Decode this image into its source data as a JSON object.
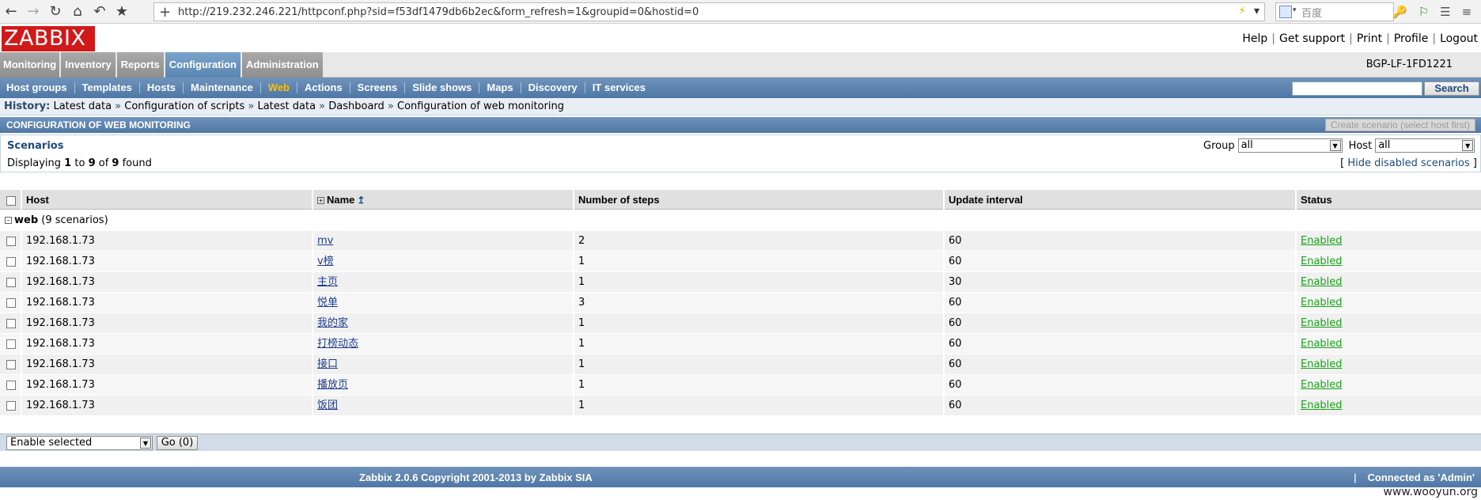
{
  "browser": {
    "url": "http://219.232.246.221/httpconf.php?sid=f53df1479db6b2ec&form_refresh=1&groupid=0&hostid=0",
    "search_placeholder": "百度"
  },
  "header": {
    "logo": "ZABBIX",
    "links": [
      "Help",
      "Get support",
      "Print",
      "Profile",
      "Logout"
    ],
    "node_name": "BGP-LF-1FD1221"
  },
  "main_menu": [
    "Monitoring",
    "Inventory",
    "Reports",
    "Configuration",
    "Administration"
  ],
  "sub_menu": [
    "Host groups",
    "Templates",
    "Hosts",
    "Maintenance",
    "Web",
    "Actions",
    "Screens",
    "Slide shows",
    "Maps",
    "Discovery",
    "IT services"
  ],
  "search_button": "Search",
  "history": {
    "label": "History:",
    "items": [
      "Latest data",
      "Configuration of scripts",
      "Latest data",
      "Dashboard",
      "Configuration of web monitoring"
    ]
  },
  "title": "CONFIGURATION OF WEB MONITORING",
  "create_button": "Create scenario (select host first)",
  "filter": {
    "section_title": "Scenarios",
    "displaying_prefix": "Displaying",
    "from": "1",
    "to_word": "to",
    "to": "9",
    "of_word": "of",
    "total": "9",
    "found_word": "found",
    "group_label": "Group",
    "group_value": "all",
    "host_label": "Host",
    "host_value": "all",
    "hide_disabled": "Hide disabled scenarios"
  },
  "table": {
    "headers": [
      "Host",
      "Name",
      "Number of steps",
      "Update interval",
      "Status"
    ],
    "group_name": "web",
    "group_count": "(9 scenarios)",
    "rows": [
      {
        "host": "192.168.1.73",
        "name": "mv",
        "steps": "2",
        "interval": "60",
        "status": "Enabled"
      },
      {
        "host": "192.168.1.73",
        "name": "v榜",
        "steps": "1",
        "interval": "60",
        "status": "Enabled"
      },
      {
        "host": "192.168.1.73",
        "name": "主页",
        "steps": "1",
        "interval": "30",
        "status": "Enabled"
      },
      {
        "host": "192.168.1.73",
        "name": "悦单",
        "steps": "3",
        "interval": "60",
        "status": "Enabled"
      },
      {
        "host": "192.168.1.73",
        "name": "我的家",
        "steps": "1",
        "interval": "60",
        "status": "Enabled"
      },
      {
        "host": "192.168.1.73",
        "name": "打榜动态",
        "steps": "1",
        "interval": "60",
        "status": "Enabled"
      },
      {
        "host": "192.168.1.73",
        "name": "接口",
        "steps": "1",
        "interval": "60",
        "status": "Enabled"
      },
      {
        "host": "192.168.1.73",
        "name": "播放页",
        "steps": "1",
        "interval": "60",
        "status": "Enabled"
      },
      {
        "host": "192.168.1.73",
        "name": "饭团",
        "steps": "1",
        "interval": "60",
        "status": "Enabled"
      }
    ]
  },
  "actions": {
    "selected_action": "Enable selected",
    "go_button": "Go (0)"
  },
  "footer": {
    "copyright": "Zabbix 2.0.6 Copyright 2001-2013 by Zabbix SIA",
    "connected": "Connected as 'Admin'"
  },
  "watermark": "www.wooyun.org",
  "colors": {
    "logo_red": "#d2191a",
    "menu_blue": "#5a86b3",
    "active_sub": "#ffc000",
    "status_green": "#16a316"
  }
}
